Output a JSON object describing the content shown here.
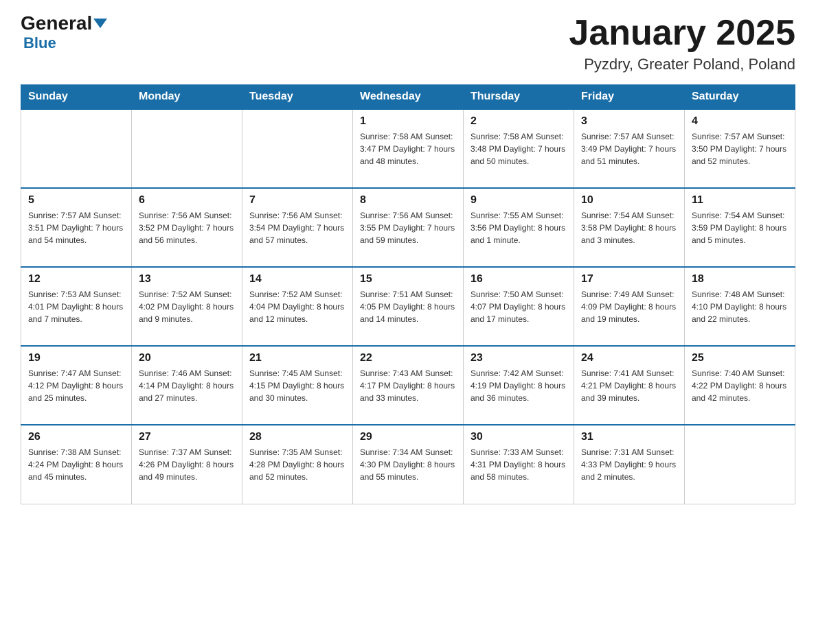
{
  "logo": {
    "general": "General",
    "blue": "Blue"
  },
  "header": {
    "month": "January 2025",
    "location": "Pyzdry, Greater Poland, Poland"
  },
  "days_of_week": [
    "Sunday",
    "Monday",
    "Tuesday",
    "Wednesday",
    "Thursday",
    "Friday",
    "Saturday"
  ],
  "weeks": [
    [
      {
        "day": "",
        "info": ""
      },
      {
        "day": "",
        "info": ""
      },
      {
        "day": "",
        "info": ""
      },
      {
        "day": "1",
        "info": "Sunrise: 7:58 AM\nSunset: 3:47 PM\nDaylight: 7 hours and 48 minutes."
      },
      {
        "day": "2",
        "info": "Sunrise: 7:58 AM\nSunset: 3:48 PM\nDaylight: 7 hours and 50 minutes."
      },
      {
        "day": "3",
        "info": "Sunrise: 7:57 AM\nSunset: 3:49 PM\nDaylight: 7 hours and 51 minutes."
      },
      {
        "day": "4",
        "info": "Sunrise: 7:57 AM\nSunset: 3:50 PM\nDaylight: 7 hours and 52 minutes."
      }
    ],
    [
      {
        "day": "5",
        "info": "Sunrise: 7:57 AM\nSunset: 3:51 PM\nDaylight: 7 hours and 54 minutes."
      },
      {
        "day": "6",
        "info": "Sunrise: 7:56 AM\nSunset: 3:52 PM\nDaylight: 7 hours and 56 minutes."
      },
      {
        "day": "7",
        "info": "Sunrise: 7:56 AM\nSunset: 3:54 PM\nDaylight: 7 hours and 57 minutes."
      },
      {
        "day": "8",
        "info": "Sunrise: 7:56 AM\nSunset: 3:55 PM\nDaylight: 7 hours and 59 minutes."
      },
      {
        "day": "9",
        "info": "Sunrise: 7:55 AM\nSunset: 3:56 PM\nDaylight: 8 hours and 1 minute."
      },
      {
        "day": "10",
        "info": "Sunrise: 7:54 AM\nSunset: 3:58 PM\nDaylight: 8 hours and 3 minutes."
      },
      {
        "day": "11",
        "info": "Sunrise: 7:54 AM\nSunset: 3:59 PM\nDaylight: 8 hours and 5 minutes."
      }
    ],
    [
      {
        "day": "12",
        "info": "Sunrise: 7:53 AM\nSunset: 4:01 PM\nDaylight: 8 hours and 7 minutes."
      },
      {
        "day": "13",
        "info": "Sunrise: 7:52 AM\nSunset: 4:02 PM\nDaylight: 8 hours and 9 minutes."
      },
      {
        "day": "14",
        "info": "Sunrise: 7:52 AM\nSunset: 4:04 PM\nDaylight: 8 hours and 12 minutes."
      },
      {
        "day": "15",
        "info": "Sunrise: 7:51 AM\nSunset: 4:05 PM\nDaylight: 8 hours and 14 minutes."
      },
      {
        "day": "16",
        "info": "Sunrise: 7:50 AM\nSunset: 4:07 PM\nDaylight: 8 hours and 17 minutes."
      },
      {
        "day": "17",
        "info": "Sunrise: 7:49 AM\nSunset: 4:09 PM\nDaylight: 8 hours and 19 minutes."
      },
      {
        "day": "18",
        "info": "Sunrise: 7:48 AM\nSunset: 4:10 PM\nDaylight: 8 hours and 22 minutes."
      }
    ],
    [
      {
        "day": "19",
        "info": "Sunrise: 7:47 AM\nSunset: 4:12 PM\nDaylight: 8 hours and 25 minutes."
      },
      {
        "day": "20",
        "info": "Sunrise: 7:46 AM\nSunset: 4:14 PM\nDaylight: 8 hours and 27 minutes."
      },
      {
        "day": "21",
        "info": "Sunrise: 7:45 AM\nSunset: 4:15 PM\nDaylight: 8 hours and 30 minutes."
      },
      {
        "day": "22",
        "info": "Sunrise: 7:43 AM\nSunset: 4:17 PM\nDaylight: 8 hours and 33 minutes."
      },
      {
        "day": "23",
        "info": "Sunrise: 7:42 AM\nSunset: 4:19 PM\nDaylight: 8 hours and 36 minutes."
      },
      {
        "day": "24",
        "info": "Sunrise: 7:41 AM\nSunset: 4:21 PM\nDaylight: 8 hours and 39 minutes."
      },
      {
        "day": "25",
        "info": "Sunrise: 7:40 AM\nSunset: 4:22 PM\nDaylight: 8 hours and 42 minutes."
      }
    ],
    [
      {
        "day": "26",
        "info": "Sunrise: 7:38 AM\nSunset: 4:24 PM\nDaylight: 8 hours and 45 minutes."
      },
      {
        "day": "27",
        "info": "Sunrise: 7:37 AM\nSunset: 4:26 PM\nDaylight: 8 hours and 49 minutes."
      },
      {
        "day": "28",
        "info": "Sunrise: 7:35 AM\nSunset: 4:28 PM\nDaylight: 8 hours and 52 minutes."
      },
      {
        "day": "29",
        "info": "Sunrise: 7:34 AM\nSunset: 4:30 PM\nDaylight: 8 hours and 55 minutes."
      },
      {
        "day": "30",
        "info": "Sunrise: 7:33 AM\nSunset: 4:31 PM\nDaylight: 8 hours and 58 minutes."
      },
      {
        "day": "31",
        "info": "Sunrise: 7:31 AM\nSunset: 4:33 PM\nDaylight: 9 hours and 2 minutes."
      },
      {
        "day": "",
        "info": ""
      }
    ]
  ]
}
